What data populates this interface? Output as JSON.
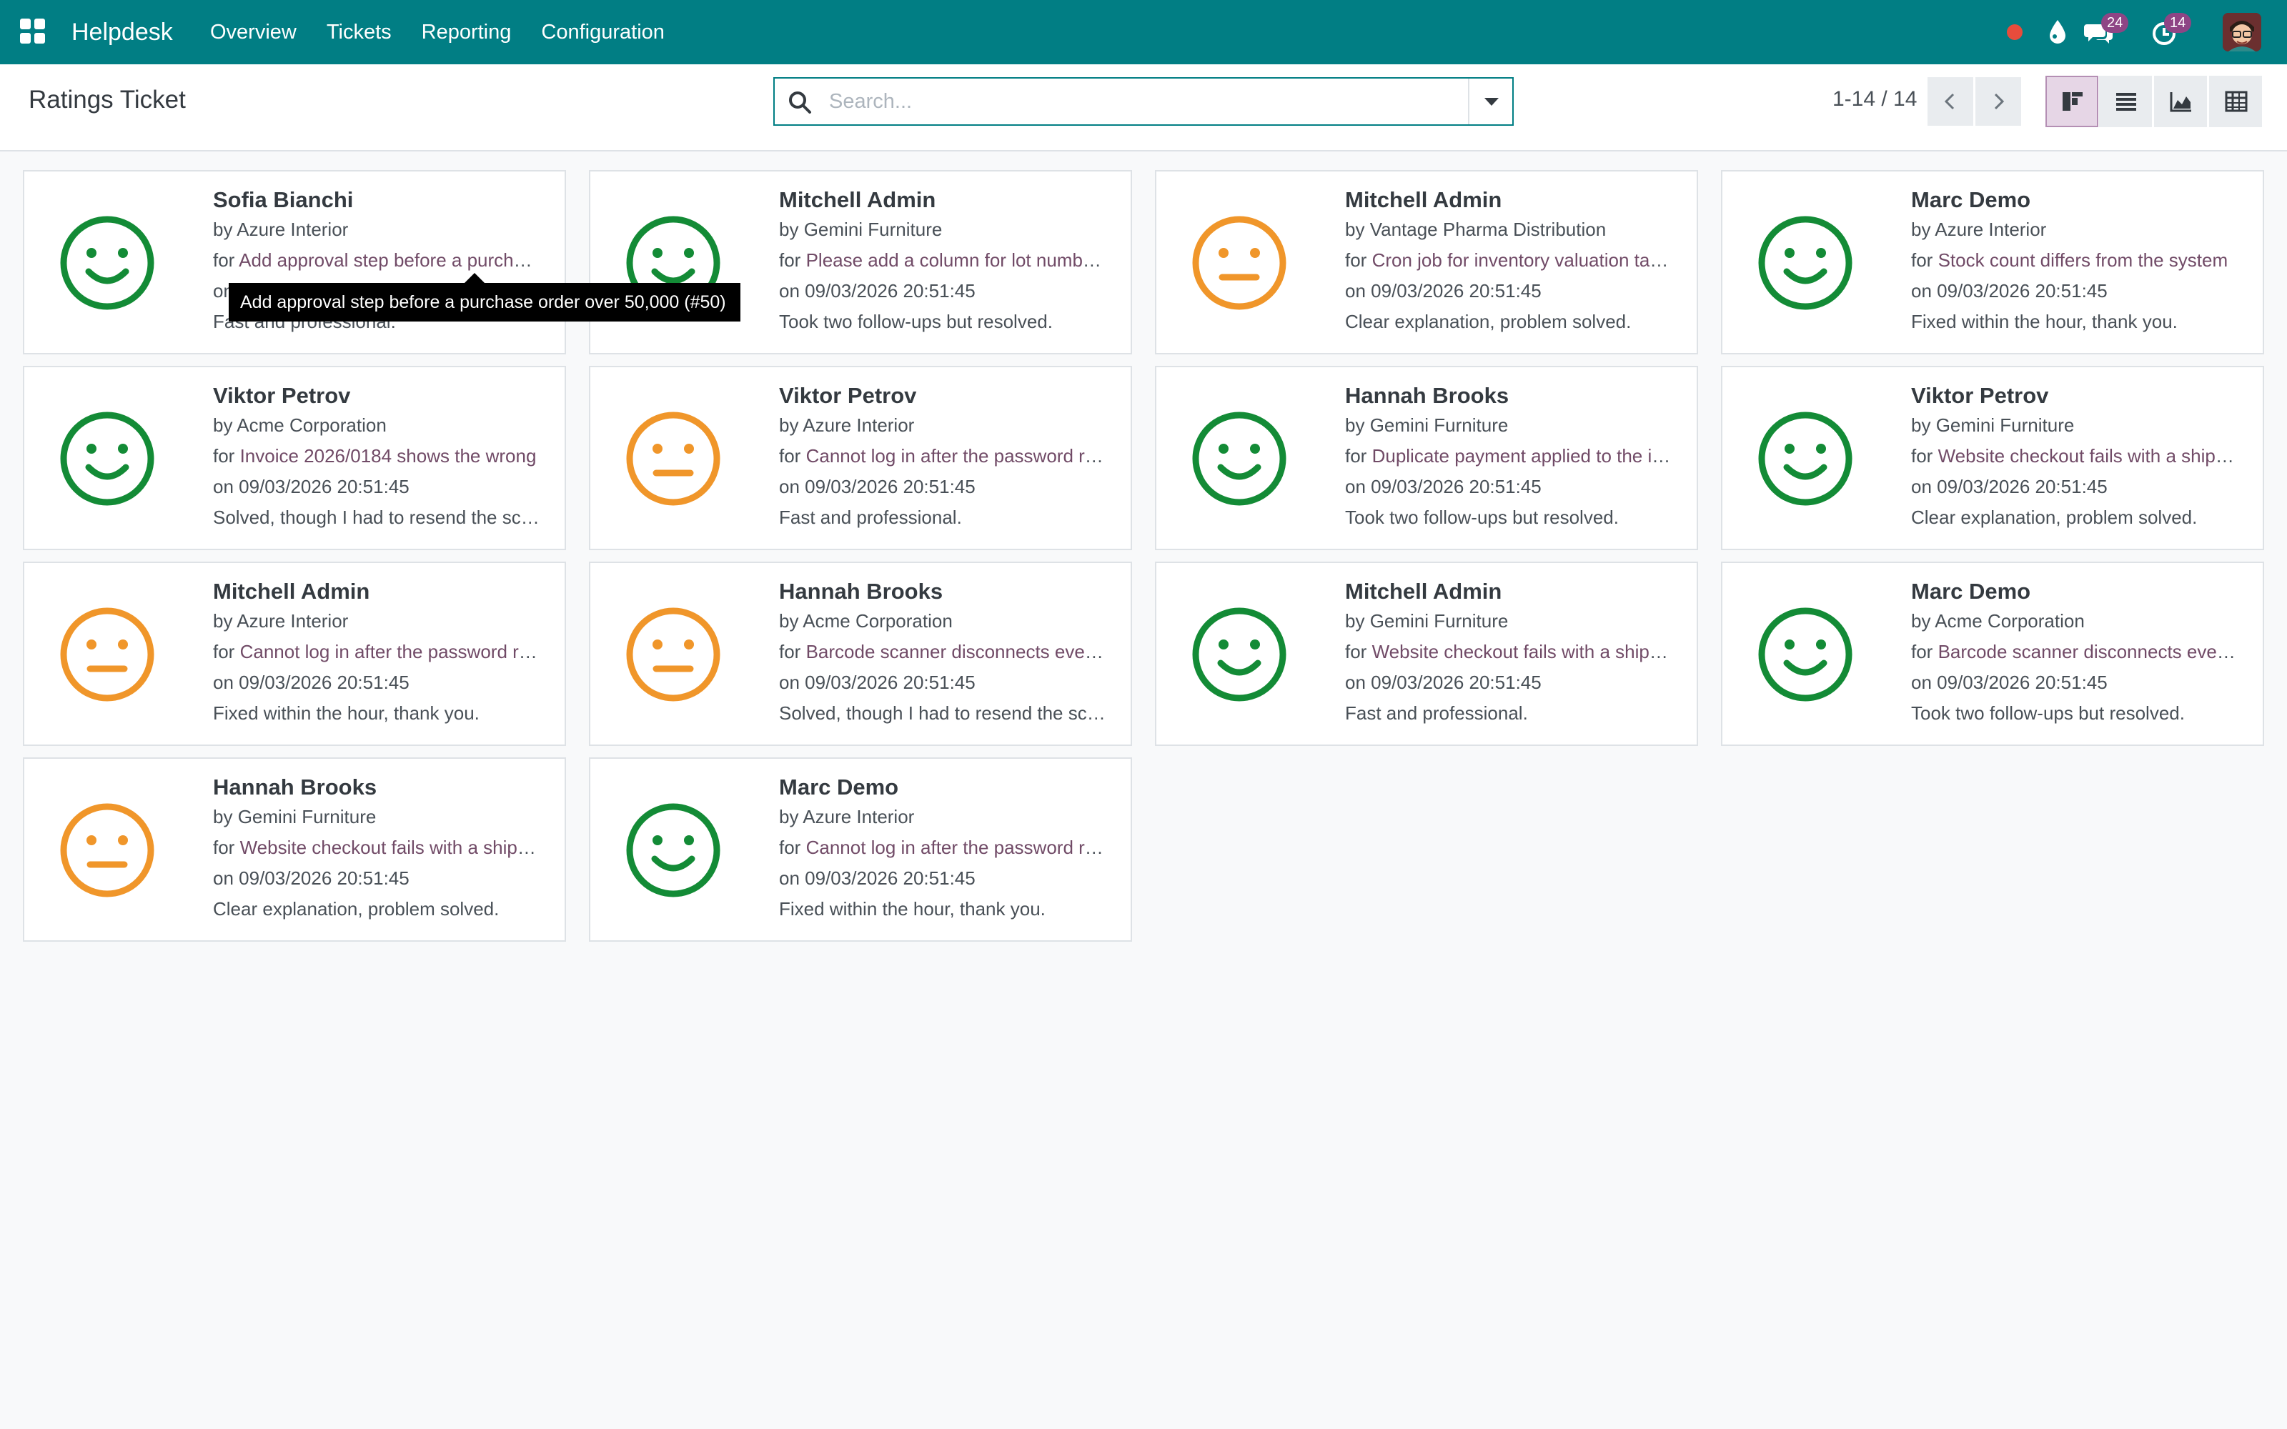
{
  "app": {
    "name": "Helpdesk",
    "menu": [
      "Overview",
      "Tickets",
      "Reporting",
      "Configuration"
    ]
  },
  "systray": {
    "messages_count": "24",
    "activities_count": "14"
  },
  "control_panel": {
    "title": "Ratings Ticket",
    "search_placeholder": "Search...",
    "pager": "1-14 / 14",
    "views": [
      "kanban",
      "list",
      "graph",
      "pivot"
    ],
    "active_view": "kanban"
  },
  "colors": {
    "navbar": "#017e84",
    "satisfied": "#138b36",
    "okay": "#f0962a",
    "link": "#714b67"
  },
  "tooltip": "Add approval step before a purchase order over 50,000 (#50)",
  "ratings": [
    {
      "name": "Sofia Bianchi",
      "by": "Azure Interior",
      "ticket": "Add approval step before a purchase order over 50,000 (#50)",
      "date": "09/03/2026 20:51:45",
      "feedback": "Fast and professional.",
      "rating": "satisfied"
    },
    {
      "name": "Mitchell Admin",
      "by": "Gemini Furniture",
      "ticket": "Please add a column for lot numbers",
      "date": "09/03/2026 20:51:45",
      "feedback": "Took two follow-ups but resolved.",
      "rating": "satisfied"
    },
    {
      "name": "Mitchell Admin",
      "by": "Vantage Pharma Distribution",
      "ticket": "Cron job for inventory valuation takes",
      "date": "09/03/2026 20:51:45",
      "feedback": "Clear explanation, problem solved.",
      "rating": "okay"
    },
    {
      "name": "Marc Demo",
      "by": "Azure Interior",
      "ticket": "Stock count differs from the system",
      "date": "09/03/2026 20:51:45",
      "feedback": "Fixed within the hour, thank you.",
      "rating": "satisfied"
    },
    {
      "name": "Viktor Petrov",
      "by": "Acme Corporation",
      "ticket": "Invoice 2026/0184 shows the wrong",
      "date": "09/03/2026 20:51:45",
      "feedback": "Solved, though I had to resend the screenshots",
      "rating": "satisfied"
    },
    {
      "name": "Viktor Petrov",
      "by": "Azure Interior",
      "ticket": "Cannot log in after the password reset",
      "date": "09/03/2026 20:51:45",
      "feedback": "Fast and professional.",
      "rating": "okay"
    },
    {
      "name": "Hannah Brooks",
      "by": "Gemini Furniture",
      "ticket": "Duplicate payment applied to the invoice",
      "date": "09/03/2026 20:51:45",
      "feedback": "Took two follow-ups but resolved.",
      "rating": "satisfied"
    },
    {
      "name": "Viktor Petrov",
      "by": "Gemini Furniture",
      "ticket": "Website checkout fails with a shipping error",
      "date": "09/03/2026 20:51:45",
      "feedback": "Clear explanation, problem solved.",
      "rating": "satisfied"
    },
    {
      "name": "Mitchell Admin",
      "by": "Azure Interior",
      "ticket": "Cannot log in after the password reset",
      "date": "09/03/2026 20:51:45",
      "feedback": "Fixed within the hour, thank you.",
      "rating": "okay"
    },
    {
      "name": "Hannah Brooks",
      "by": "Acme Corporation",
      "ticket": "Barcode scanner disconnects every hour",
      "date": "09/03/2026 20:51:45",
      "feedback": "Solved, though I had to resend the screenshots",
      "rating": "okay"
    },
    {
      "name": "Mitchell Admin",
      "by": "Gemini Furniture",
      "ticket": "Website checkout fails with a shipping error",
      "date": "09/03/2026 20:51:45",
      "feedback": "Fast and professional.",
      "rating": "satisfied"
    },
    {
      "name": "Marc Demo",
      "by": "Acme Corporation",
      "ticket": "Barcode scanner disconnects every hour",
      "date": "09/03/2026 20:51:45",
      "feedback": "Took two follow-ups but resolved.",
      "rating": "satisfied"
    },
    {
      "name": "Hannah Brooks",
      "by": "Gemini Furniture",
      "ticket": "Website checkout fails with a shipping error",
      "date": "09/03/2026 20:51:45",
      "feedback": "Clear explanation, problem solved.",
      "rating": "okay"
    },
    {
      "name": "Marc Demo",
      "by": "Azure Interior",
      "ticket": "Cannot log in after the password reset",
      "date": "09/03/2026 20:51:45",
      "feedback": "Fixed within the hour, thank you.",
      "rating": "satisfied"
    }
  ],
  "labels": {
    "by": "by",
    "for": "for",
    "on": "on"
  }
}
